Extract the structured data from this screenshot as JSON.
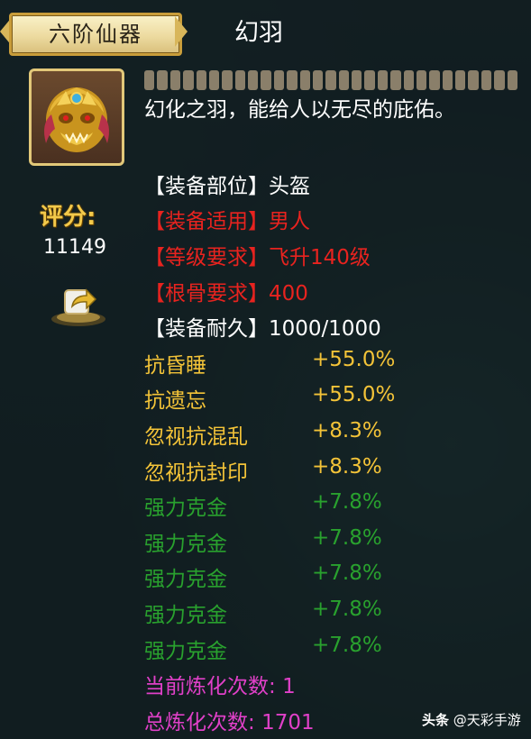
{
  "header": {
    "grade_label": "六阶仙器",
    "item_name": "幻羽"
  },
  "score": {
    "label": "评分:",
    "value": "11149"
  },
  "description": "幻化之羽，能给人以无尽的庇佑。",
  "attributes": [
    {
      "label": "【装备部位】",
      "value": "头盔",
      "color": "white"
    },
    {
      "label": "【装备适用】",
      "value": "男人",
      "color": "red"
    },
    {
      "label": "【等级要求】",
      "value": "飞升140级",
      "color": "red"
    },
    {
      "label": "【根骨要求】",
      "value": "400",
      "color": "red"
    },
    {
      "label": "【装备耐久】",
      "value": "1000/1000",
      "color": "white"
    }
  ],
  "stats": [
    {
      "name": "抗昏睡",
      "value": "+55.0%",
      "color": "yellow"
    },
    {
      "name": "抗遗忘",
      "value": "+55.0%",
      "color": "yellow"
    },
    {
      "name": "忽视抗混乱",
      "value": "+8.3%",
      "color": "yellow"
    },
    {
      "name": "忽视抗封印",
      "value": "+8.3%",
      "color": "yellow"
    },
    {
      "name": "强力克金",
      "value": "+7.8%",
      "color": "green"
    },
    {
      "name": "强力克金",
      "value": "+7.8%",
      "color": "green"
    },
    {
      "name": "强力克金",
      "value": "+7.8%",
      "color": "green"
    },
    {
      "name": "强力克金",
      "value": "+7.8%",
      "color": "green"
    },
    {
      "name": "强力克金",
      "value": "+7.8%",
      "color": "green"
    }
  ],
  "refine": {
    "current_label": "当前炼化次数:",
    "current_value": "1",
    "total_label": "总炼化次数:",
    "total_value": "1701"
  },
  "watermark": {
    "brand": "头条",
    "handle": "@天彩手游"
  },
  "colors": {
    "white": "#ffffff",
    "red": "#e8231f",
    "yellow": "#f3c338",
    "green": "#29a12e",
    "magenta": "#e040c8",
    "gold": "#f3c94a"
  }
}
